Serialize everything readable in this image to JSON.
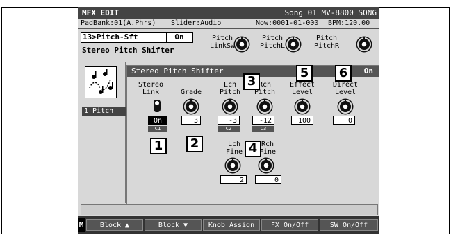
{
  "header": {
    "title": "MFX EDIT",
    "song": "Song 01 MV-8800 SONG",
    "padbank": "PadBank:01(A.Phrs)",
    "slider": "Slider:Audio",
    "now": "Now:0001-01-000",
    "bpm": "BPM:120.00"
  },
  "fx": {
    "name": "13>Pitch-Sft",
    "switch": "On",
    "description": "Stereo Pitch Shifter"
  },
  "top_knobs": [
    {
      "label1": "Pitch",
      "label2": "LinkSw"
    },
    {
      "label1": "Pitch",
      "label2": "PitchL"
    },
    {
      "label1": "Pitch",
      "label2": "PitchR"
    }
  ],
  "left": {
    "icon": "note-wave-icon",
    "tab": "1 Pitch"
  },
  "panel": {
    "title": "Stereo Pitch Shifter",
    "switch": "On",
    "params": {
      "stereo_link": {
        "label1": "Stereo",
        "label2": "Link",
        "value": "On",
        "ctrl": "C1"
      },
      "grade": {
        "label1": "",
        "label2": "Grade",
        "value": "3"
      },
      "lch_pitch": {
        "label1": "Lch",
        "label2": "Pitch",
        "value": "-3",
        "ctrl": "C2"
      },
      "rch_pitch": {
        "label1": "Rch",
        "label2": "Pitch",
        "value": "-12",
        "ctrl": "C3"
      },
      "effect_level": {
        "label1": "Effect",
        "label2": "Level",
        "value": "100"
      },
      "direct_level": {
        "label1": "Direct",
        "label2": "Level",
        "value": "0"
      },
      "lch_fine": {
        "label1": "Lch",
        "label2": "Fine",
        "value": "2"
      },
      "rch_fine": {
        "label1": "Rch",
        "label2": "Fine",
        "value": "0"
      }
    }
  },
  "callouts": [
    "1",
    "2",
    "3",
    "4",
    "5",
    "6"
  ],
  "function_buttons": {
    "m": "M",
    "block_up": "Block ▲",
    "block_down": "Block ▼",
    "knob_assign": "Knob Assign",
    "fx_onoff": "FX On/Off",
    "sw_onoff": "SW On/Off"
  }
}
